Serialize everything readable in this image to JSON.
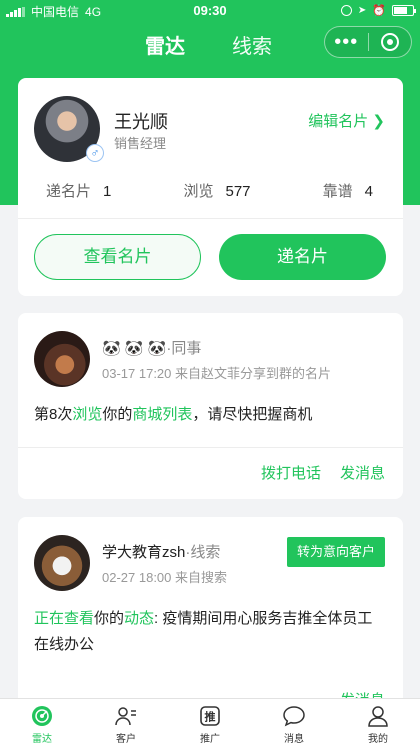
{
  "status_bar": {
    "carrier": "中国电信",
    "network": "4G",
    "time": "09:30"
  },
  "nav": {
    "tabs": [
      "雷达",
      "线索"
    ],
    "more": "•••"
  },
  "profile": {
    "name": "王光顺",
    "title": "销售经理",
    "edit_label": "编辑名片",
    "stats": [
      {
        "label": "递名片",
        "value": "1"
      },
      {
        "label": "浏览",
        "value": "577"
      },
      {
        "label": "靠谱",
        "value": "4"
      }
    ],
    "view_card_button": "查看名片",
    "send_card_button": "递名片"
  },
  "activities": [
    {
      "name": "🐼 🐼 🐼",
      "tag": "·同事",
      "meta": "03-17 17:20  来自赵文菲分享到群的名片",
      "text_prefix": "第8次",
      "text_hl1": "浏览",
      "text_mid": "你的",
      "text_hl2": "商城列表",
      "text_suffix": "，请尽快把握商机",
      "call_label": "拨打电话",
      "message_label": "发消息"
    },
    {
      "name": "学大教育zsh",
      "tag": "·线索",
      "meta": "02-27 18:00  来自搜索",
      "intent_label": "转为意向客户",
      "text_hl1": "正在查看",
      "text_mid": "你的",
      "text_hl2": "动态",
      "text_suffix": ": 疫情期间用心服务吉推全体员工在线办公",
      "message_label": "发消息"
    }
  ],
  "tabbar": [
    {
      "label": "雷达",
      "icon": "radar-icon",
      "active": true
    },
    {
      "label": "客户",
      "icon": "customers-icon",
      "active": false
    },
    {
      "label": "推广",
      "icon": "promote-icon",
      "active": false
    },
    {
      "label": "消息",
      "icon": "chat-bubble-icon",
      "active": false
    },
    {
      "label": "我的",
      "icon": "profile-icon",
      "active": false
    }
  ],
  "colors": {
    "primary": "#21c45c",
    "background": "#f2f3f5"
  }
}
